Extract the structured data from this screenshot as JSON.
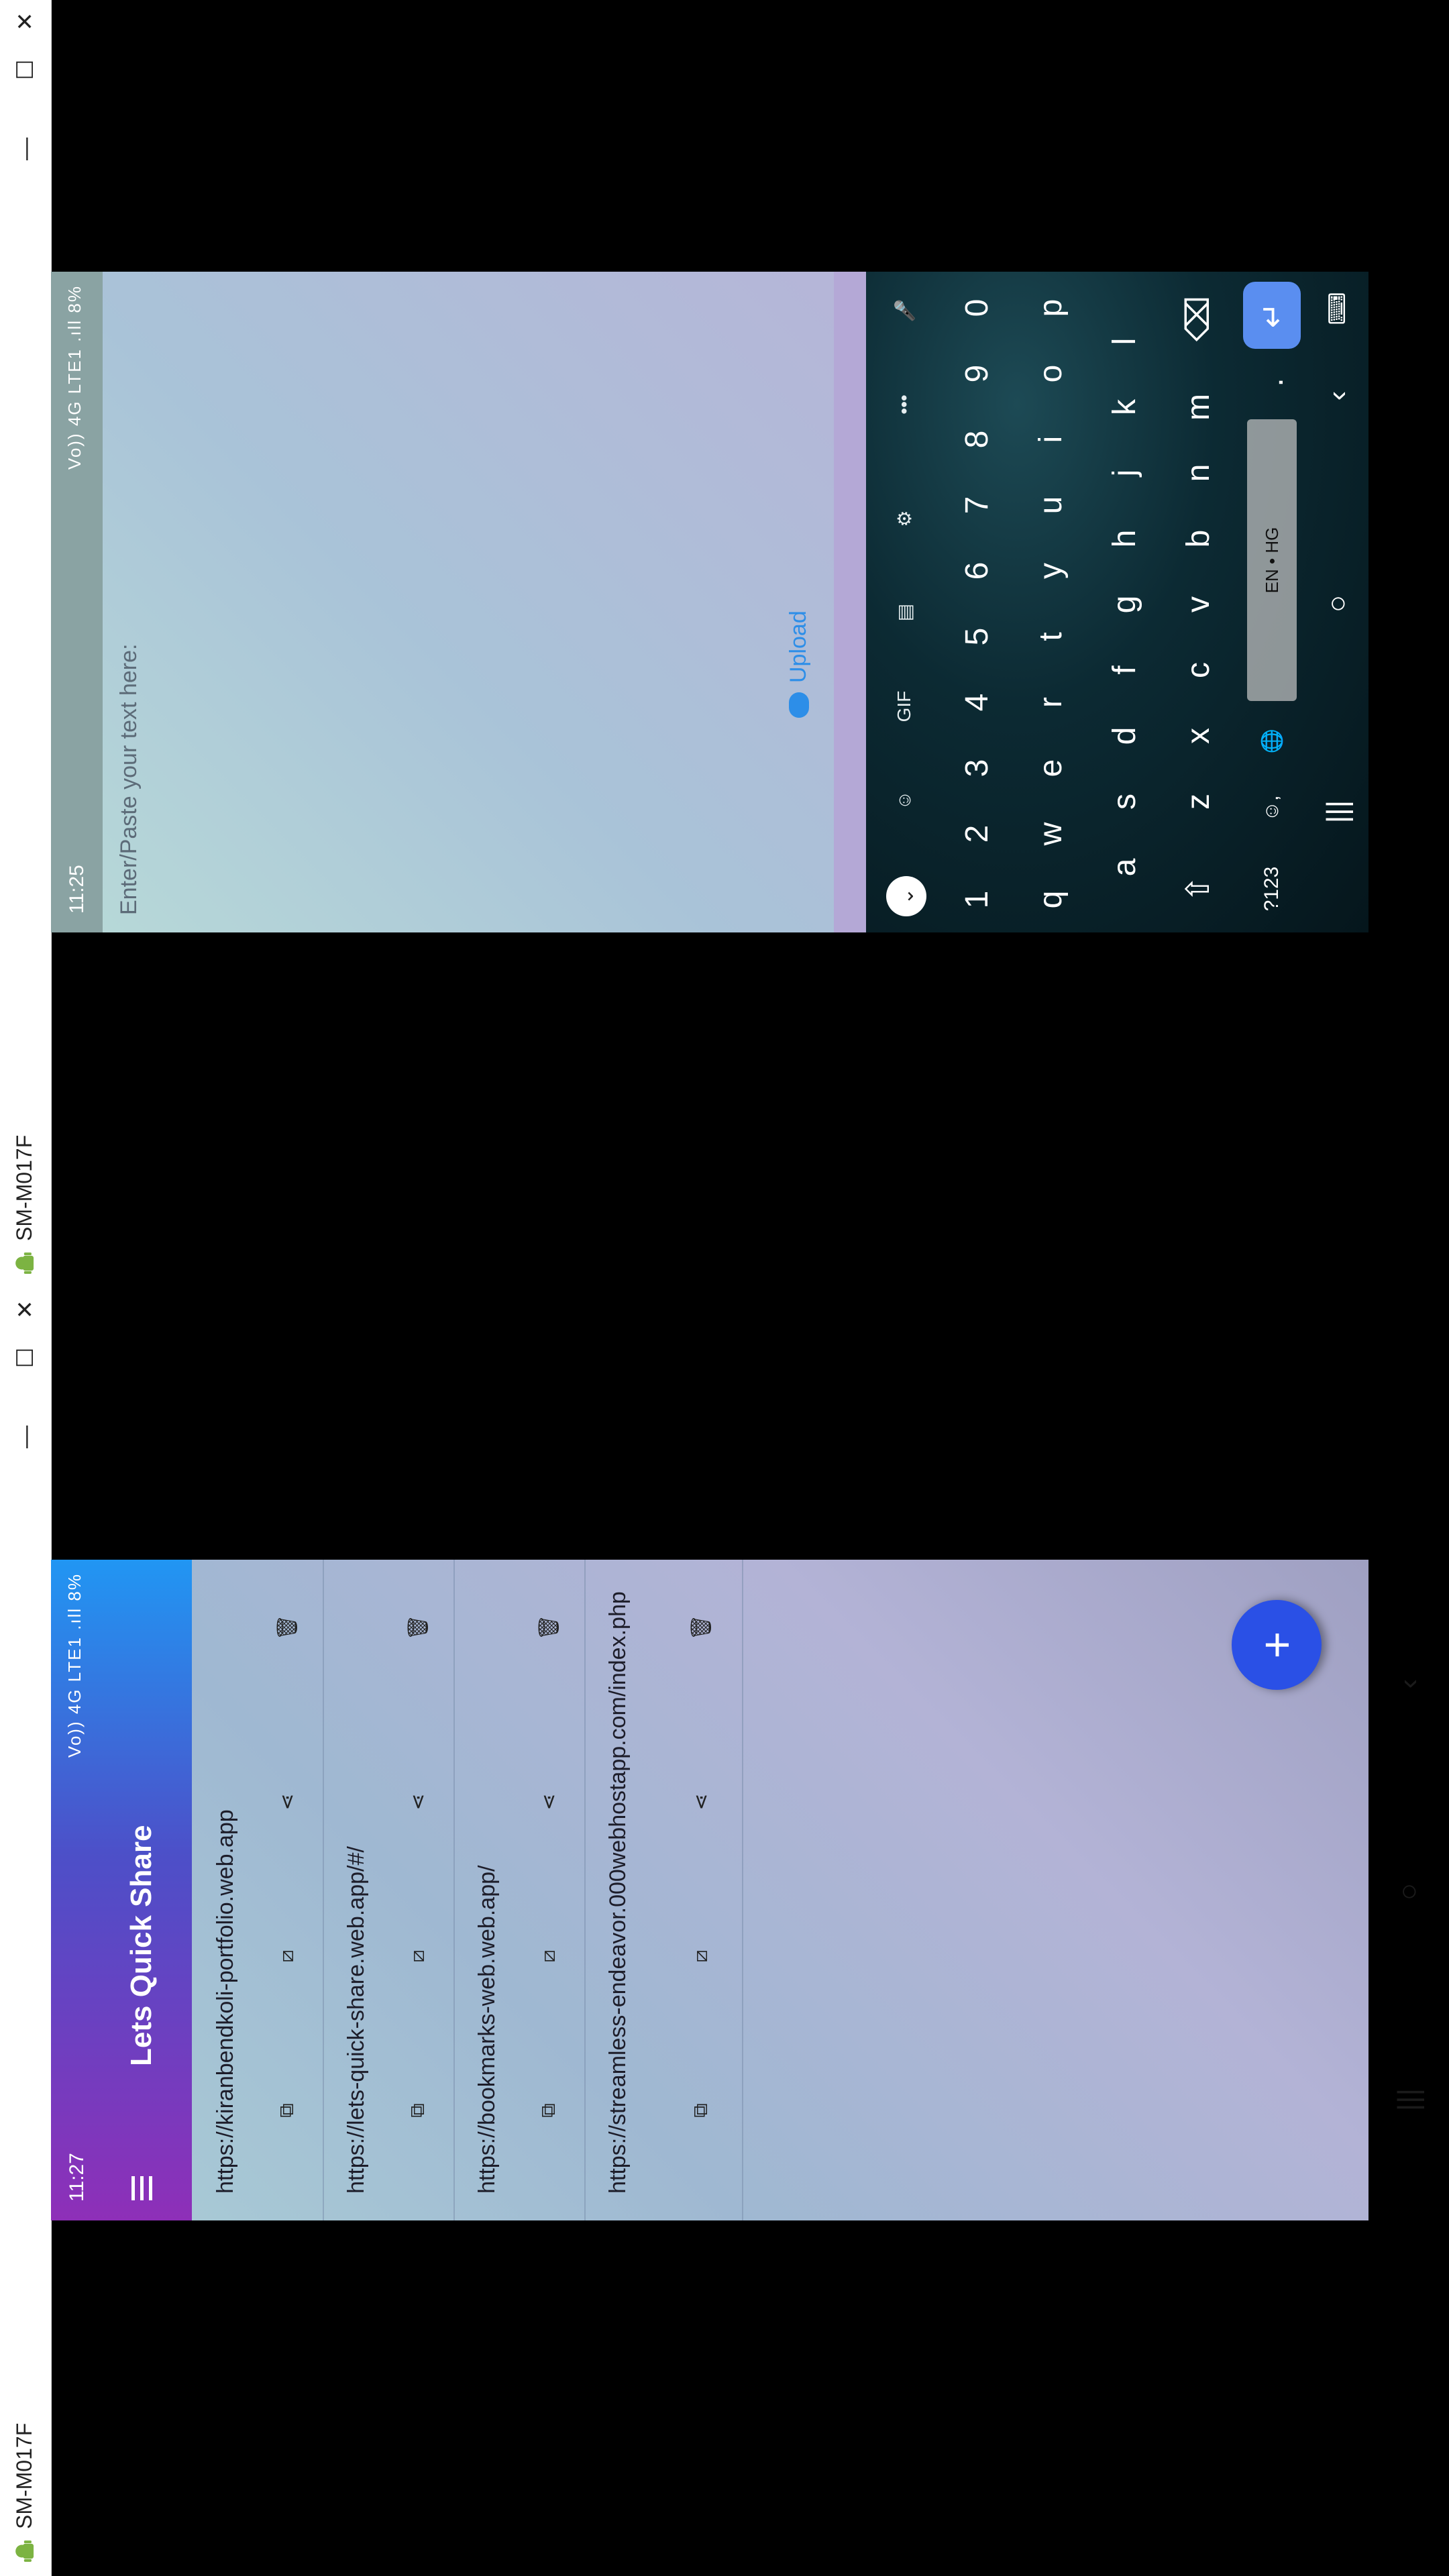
{
  "windows": {
    "device_name": "SM-M017F",
    "window_buttons": {
      "minimize": "—",
      "maximize": "☐",
      "close": "✕"
    }
  },
  "left_phone": {
    "status": {
      "time": "11:27",
      "indicators": "Vo)) 4G LTE1 .ıll 8%"
    },
    "app_title": "Lets Quick Share",
    "links": [
      {
        "url": "https://kiranbendkoli-portfolio.web.app"
      },
      {
        "url": "https://lets-quick-share.web.app/#/"
      },
      {
        "url": "https://bookmarks-web.web.app/"
      },
      {
        "url": "https://streamless-endeavor.000webhostapp.com/index.php"
      }
    ],
    "fab_label": "+",
    "nav": {
      "recents": "|||",
      "home": "○",
      "back": "‹"
    }
  },
  "right_phone": {
    "status": {
      "time": "11:25",
      "indicators": "Vo)) 4G LTE1 .ıll 8%"
    },
    "placeholder": "Enter/Paste your text here:",
    "upload_label": "Upload",
    "keyboard": {
      "toolbar": [
        "⌄",
        "☺",
        "GIF",
        "▤",
        "⚙",
        "•••",
        "🎤"
      ],
      "numbers": [
        "1",
        "2",
        "3",
        "4",
        "5",
        "6",
        "7",
        "8",
        "9",
        "0"
      ],
      "row1": [
        "q",
        "w",
        "e",
        "r",
        "t",
        "y",
        "u",
        "i",
        "o",
        "p"
      ],
      "row2": [
        "a",
        "s",
        "d",
        "f",
        "g",
        "h",
        "j",
        "k",
        "l"
      ],
      "row3": [
        "⇧",
        "z",
        "x",
        "c",
        "v",
        "b",
        "n",
        "m",
        "⌫"
      ],
      "bottom": {
        "sym": "?123",
        "emoji": "☺,",
        "globe": "🌐",
        "space": "EN • HG",
        "period": ".",
        "enter": "↵"
      }
    },
    "nav": {
      "recents": "|||",
      "home": "○",
      "back": "‹",
      "keyboard": "⌨"
    }
  }
}
